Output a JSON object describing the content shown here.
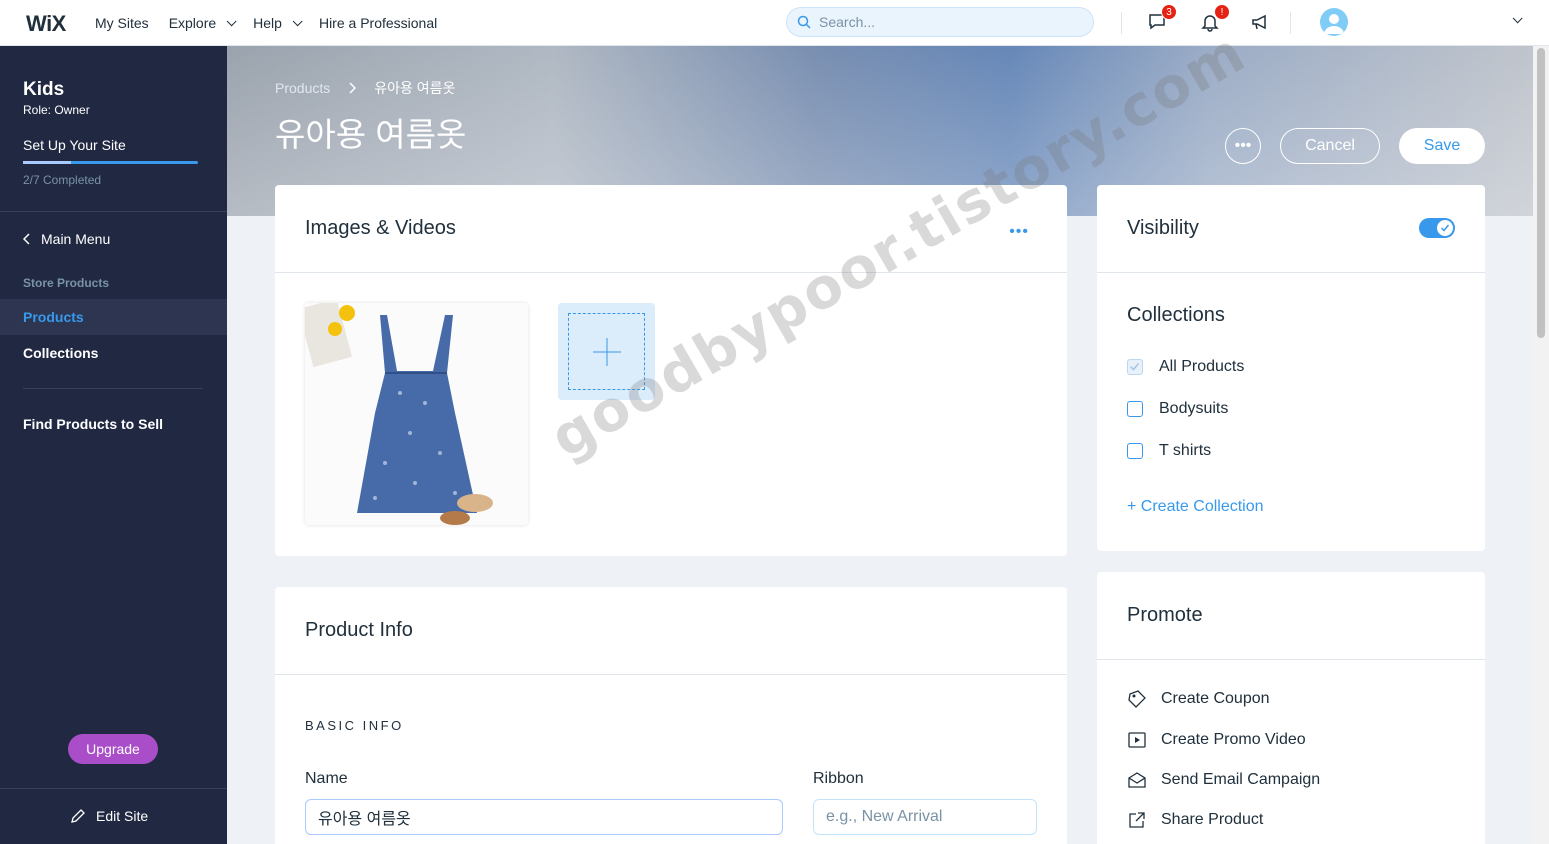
{
  "topbar": {
    "logo": "WiX",
    "nav": [
      "My Sites",
      "Explore",
      "Help",
      "Hire a Professional"
    ],
    "search_placeholder": "Search...",
    "messages_badge": "3",
    "notifications_badge": "!"
  },
  "sidebar": {
    "site_name": "Kids",
    "role": "Role: Owner",
    "setup": "Set Up Your Site",
    "completed": "2/7 Completed",
    "progress": 0.2857,
    "main_menu": "Main Menu",
    "section_title": "Store Products",
    "items": [
      "Products",
      "Collections",
      "Find Products to Sell"
    ],
    "upgrade": "Upgrade",
    "edit_site": "Edit Site"
  },
  "header": {
    "breadcrumb": [
      "Products",
      "유아용 여름옷"
    ],
    "title": "유아용 여름옷",
    "more": "•••",
    "cancel": "Cancel",
    "save": "Save"
  },
  "media": {
    "title": "Images & Videos",
    "more": "•••"
  },
  "visibility": {
    "title": "Visibility",
    "enabled": true
  },
  "collections": {
    "title": "Collections",
    "items": [
      {
        "label": "All Products",
        "checked": true,
        "disabled": true
      },
      {
        "label": "Bodysuits",
        "checked": false
      },
      {
        "label": "T shirts",
        "checked": false
      }
    ],
    "create": "+ Create Collection"
  },
  "product_info": {
    "title": "Product Info",
    "section": "BASIC INFO",
    "name_label": "Name",
    "name_value": "유아용 여름옷",
    "ribbon_label": "Ribbon",
    "ribbon_placeholder": "e.g., New Arrival"
  },
  "promote": {
    "title": "Promote",
    "items": [
      "Create Coupon",
      "Create Promo Video",
      "Send Email Campaign",
      "Share Product"
    ]
  },
  "watermark": "goodbypoor.tistory.com",
  "colors": {
    "accent": "#3899ec",
    "sidebar": "#212942",
    "upgrade": "#aa4dc8",
    "badge": "#e62214"
  }
}
